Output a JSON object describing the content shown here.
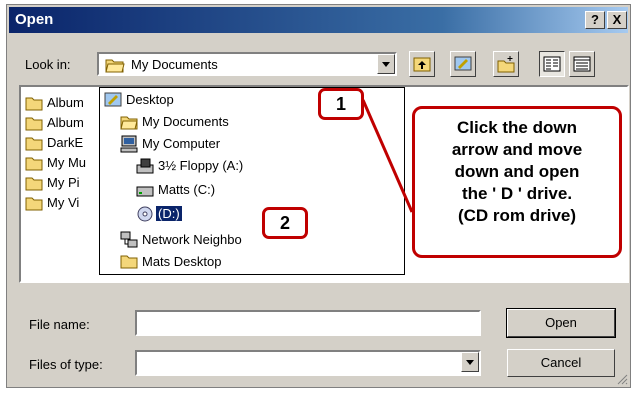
{
  "window": {
    "title": "Open",
    "help_label": "?",
    "close_label": "X"
  },
  "toolbar": {
    "look_in_label": "Look in:",
    "look_in_value": "My Documents",
    "tools": [
      "up-one-level-icon",
      "desktop-icon",
      "new-folder-icon",
      "list-view-icon",
      "details-view-icon"
    ]
  },
  "file_list": [
    "Album",
    "Album",
    "DarkE",
    "My Mu",
    "My Pi",
    "My Vi"
  ],
  "dropdown": {
    "items": [
      {
        "label": "Desktop",
        "icon": "desktop-icon",
        "indent": 0
      },
      {
        "label": "My Documents",
        "icon": "folder-open-icon",
        "indent": 1
      },
      {
        "label": "My Computer",
        "icon": "computer-icon",
        "indent": 1
      },
      {
        "label": "3½ Floppy (A:)",
        "icon": "floppy-drive-icon",
        "indent": 2
      },
      {
        "label": "Matts (C:)",
        "icon": "hard-drive-icon",
        "indent": 2
      },
      {
        "label": "(D:)",
        "icon": "cd-drive-icon",
        "indent": 2,
        "selected": true
      },
      {
        "label": "Network Neighbo",
        "icon": "network-icon",
        "indent": 1
      },
      {
        "label": "Mats Desktop",
        "icon": "folder-icon",
        "indent": 1
      }
    ]
  },
  "form": {
    "file_name_label": "File name:",
    "file_name_value": "",
    "files_of_type_label": "Files of type:",
    "files_of_type_value": ""
  },
  "buttons": {
    "open_label": "Open",
    "cancel_label": "Cancel"
  },
  "annotations": {
    "callout_1": "1",
    "callout_2": "2",
    "note": "Click the down\narrow and move\ndown and open\nthe ' D ' drive.\n(CD rom drive)",
    "color": "#c00000"
  },
  "colors": {
    "title_bar": "#0a246a",
    "dialog_bg": "#d4d0c8",
    "selection": "#0a246a"
  }
}
